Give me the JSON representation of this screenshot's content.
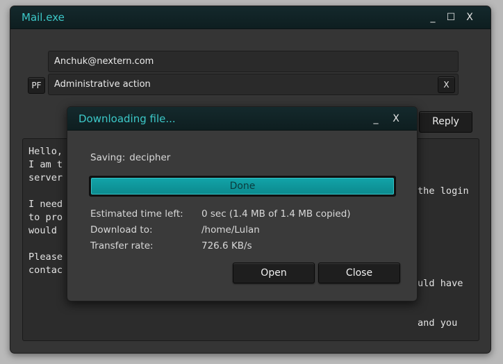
{
  "window": {
    "title": "Mail.exe",
    "minimize": "_",
    "maximize": "☐",
    "close": "X"
  },
  "mail": {
    "to_value": "Anchuk@nextern.com",
    "pf_label": "PF",
    "subject_value": "Administrative action",
    "clear_label": "X",
    "reply_label": "Reply",
    "body_lines": [
      "Hello,",
      "I am t",
      "server",
      "",
      "I need",
      "to pro",
      "would",
      "",
      "Please",
      "contac"
    ],
    "body_right_fragments": [
      "the login",
      "uld have",
      "and you"
    ]
  },
  "dialog": {
    "title": "Downloading file...",
    "minimize": "_",
    "close": "X",
    "saving_label": "Saving:",
    "saving_value": "decipher",
    "progress_percent": 100,
    "progress_label": "Done",
    "rows": [
      {
        "key": "Estimated time left:",
        "value": "0 sec (1.4 MB of 1.4 MB copied)"
      },
      {
        "key": "Download to:",
        "value": "/home/Lulan"
      },
      {
        "key": "Transfer rate:",
        "value": "726.6 KB/s"
      }
    ],
    "open_label": "Open",
    "close_label": "Close"
  },
  "colors": {
    "accent": "#3cc8c8",
    "progress_fill": "#12a3a8"
  }
}
